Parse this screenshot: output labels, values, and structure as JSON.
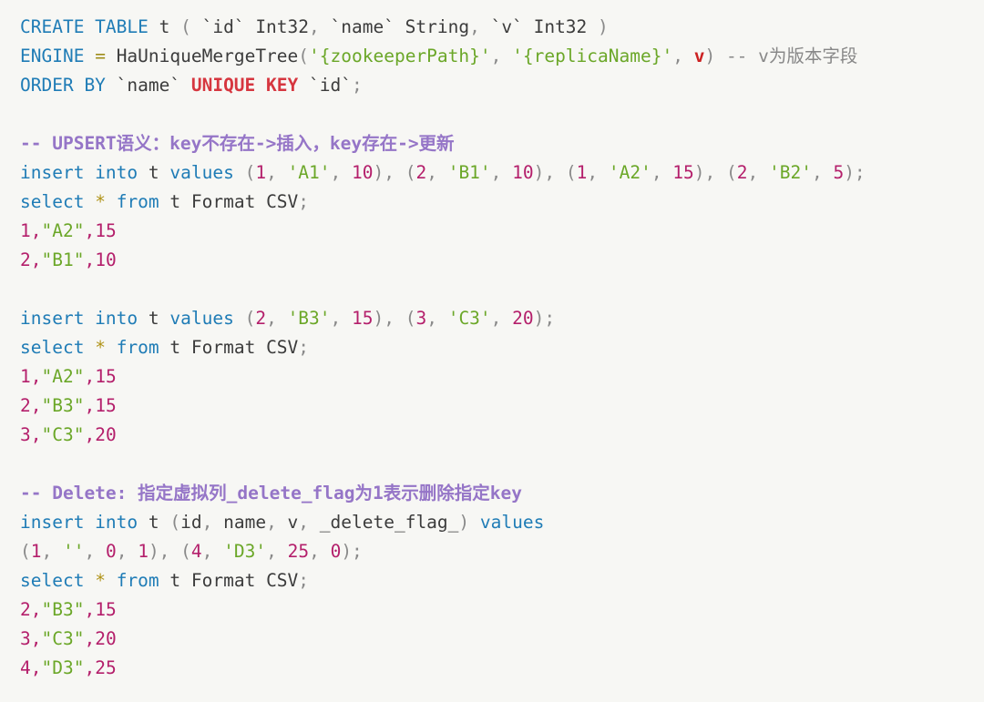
{
  "editor": {
    "language": "sql",
    "background_color": "#f7f7f4",
    "default_text_color": "#3c3c3c",
    "colors": {
      "keyword": "#1f7cb6",
      "keyword_emphasis": "#d6363f",
      "string": "#6ba728",
      "number": "#b41f6b",
      "punctuation": "#8a8a8a",
      "comment": "#888888",
      "comment_cjk": "#9575c7",
      "operator": "#9e8c18"
    }
  },
  "lines": [
    {
      "id": "line-1",
      "text": "CREATE TABLE t ( `id` Int32, `name` String, `v` Int32 )",
      "tokens": [
        {
          "t": "CREATE TABLE",
          "c": "kw"
        },
        {
          "t": " t ",
          "c": "ident"
        },
        {
          "t": "(",
          "c": "punc"
        },
        {
          "t": " `id` Int32",
          "c": "ident"
        },
        {
          "t": ",",
          "c": "punc"
        },
        {
          "t": " `name` String",
          "c": "ident"
        },
        {
          "t": ",",
          "c": "punc"
        },
        {
          "t": " `v` Int32 ",
          "c": "ident"
        },
        {
          "t": ")",
          "c": "punc"
        }
      ]
    },
    {
      "id": "line-2",
      "text": "ENGINE = HaUniqueMergeTree('{zookeeperPath}', '{replicaName}', v) -- v为版本字段",
      "tokens": [
        {
          "t": "ENGINE",
          "c": "kw"
        },
        {
          "t": " ",
          "c": "ident"
        },
        {
          "t": "=",
          "c": "op"
        },
        {
          "t": " HaUniqueMergeTree",
          "c": "ident"
        },
        {
          "t": "(",
          "c": "punc"
        },
        {
          "t": "'{zookeeperPath}'",
          "c": "str"
        },
        {
          "t": ", ",
          "c": "punc"
        },
        {
          "t": "'{replicaName}'",
          "c": "str"
        },
        {
          "t": ", ",
          "c": "punc"
        },
        {
          "t": "v",
          "c": "vcol"
        },
        {
          "t": ")",
          "c": "punc"
        },
        {
          "t": " -- v为版本字段",
          "c": "cmt"
        }
      ]
    },
    {
      "id": "line-3",
      "text": "ORDER BY `name` UNIQUE KEY `id`;",
      "tokens": [
        {
          "t": "ORDER BY",
          "c": "kw"
        },
        {
          "t": " `name` ",
          "c": "ident"
        },
        {
          "t": "UNIQUE KEY",
          "c": "kw2"
        },
        {
          "t": " `id`",
          "c": "ident"
        },
        {
          "t": ";",
          "c": "punc"
        }
      ]
    },
    {
      "id": "line-4",
      "text": "",
      "tokens": []
    },
    {
      "id": "line-5",
      "text": "-- UPSERT语义：key不存在->插入，key存在->更新",
      "tokens": [
        {
          "t": "-- UPSERT语义：key不存在->插入，key存在->更新",
          "c": "cmt-cn"
        }
      ]
    },
    {
      "id": "line-6",
      "text": "insert into t values (1, 'A1', 10), (2, 'B1', 10), (1, 'A2', 15), (2, 'B2', 5);",
      "tokens": [
        {
          "t": "insert into",
          "c": "kw"
        },
        {
          "t": " t ",
          "c": "ident"
        },
        {
          "t": "values",
          "c": "kw"
        },
        {
          "t": " ",
          "c": "ident"
        },
        {
          "t": "(",
          "c": "punc"
        },
        {
          "t": "1",
          "c": "num"
        },
        {
          "t": ", ",
          "c": "punc"
        },
        {
          "t": "'A1'",
          "c": "str"
        },
        {
          "t": ", ",
          "c": "punc"
        },
        {
          "t": "10",
          "c": "num"
        },
        {
          "t": "), (",
          "c": "punc"
        },
        {
          "t": "2",
          "c": "num"
        },
        {
          "t": ", ",
          "c": "punc"
        },
        {
          "t": "'B1'",
          "c": "str"
        },
        {
          "t": ", ",
          "c": "punc"
        },
        {
          "t": "10",
          "c": "num"
        },
        {
          "t": "), (",
          "c": "punc"
        },
        {
          "t": "1",
          "c": "num"
        },
        {
          "t": ", ",
          "c": "punc"
        },
        {
          "t": "'A2'",
          "c": "str"
        },
        {
          "t": ", ",
          "c": "punc"
        },
        {
          "t": "15",
          "c": "num"
        },
        {
          "t": "), (",
          "c": "punc"
        },
        {
          "t": "2",
          "c": "num"
        },
        {
          "t": ", ",
          "c": "punc"
        },
        {
          "t": "'B2'",
          "c": "str"
        },
        {
          "t": ", ",
          "c": "punc"
        },
        {
          "t": "5",
          "c": "num"
        },
        {
          "t": ");",
          "c": "punc"
        }
      ]
    },
    {
      "id": "line-7",
      "text": "select * from t Format CSV;",
      "tokens": [
        {
          "t": "select",
          "c": "kw"
        },
        {
          "t": " ",
          "c": "ident"
        },
        {
          "t": "*",
          "c": "star"
        },
        {
          "t": " ",
          "c": "ident"
        },
        {
          "t": "from",
          "c": "kw"
        },
        {
          "t": " t Format CSV",
          "c": "ident"
        },
        {
          "t": ";",
          "c": "punc"
        }
      ]
    },
    {
      "id": "line-8",
      "text": "1,\"A2\",15",
      "tokens": [
        {
          "t": "1",
          "c": "res-num"
        },
        {
          "t": ",",
          "c": "res-sep"
        },
        {
          "t": "\"A2\"",
          "c": "res-str"
        },
        {
          "t": ",",
          "c": "res-sep"
        },
        {
          "t": "15",
          "c": "res-num"
        }
      ]
    },
    {
      "id": "line-9",
      "text": "2,\"B1\",10",
      "tokens": [
        {
          "t": "2",
          "c": "res-num"
        },
        {
          "t": ",",
          "c": "res-sep"
        },
        {
          "t": "\"B1\"",
          "c": "res-str"
        },
        {
          "t": ",",
          "c": "res-sep"
        },
        {
          "t": "10",
          "c": "res-num"
        }
      ]
    },
    {
      "id": "line-10",
      "text": "",
      "tokens": []
    },
    {
      "id": "line-11",
      "text": "insert into t values (2, 'B3', 15), (3, 'C3', 20);",
      "tokens": [
        {
          "t": "insert into",
          "c": "kw"
        },
        {
          "t": " t ",
          "c": "ident"
        },
        {
          "t": "values",
          "c": "kw"
        },
        {
          "t": " ",
          "c": "ident"
        },
        {
          "t": "(",
          "c": "punc"
        },
        {
          "t": "2",
          "c": "num"
        },
        {
          "t": ", ",
          "c": "punc"
        },
        {
          "t": "'B3'",
          "c": "str"
        },
        {
          "t": ", ",
          "c": "punc"
        },
        {
          "t": "15",
          "c": "num"
        },
        {
          "t": "), (",
          "c": "punc"
        },
        {
          "t": "3",
          "c": "num"
        },
        {
          "t": ", ",
          "c": "punc"
        },
        {
          "t": "'C3'",
          "c": "str"
        },
        {
          "t": ", ",
          "c": "punc"
        },
        {
          "t": "20",
          "c": "num"
        },
        {
          "t": ");",
          "c": "punc"
        }
      ]
    },
    {
      "id": "line-12",
      "text": "select * from t Format CSV;",
      "tokens": [
        {
          "t": "select",
          "c": "kw"
        },
        {
          "t": " ",
          "c": "ident"
        },
        {
          "t": "*",
          "c": "star"
        },
        {
          "t": " ",
          "c": "ident"
        },
        {
          "t": "from",
          "c": "kw"
        },
        {
          "t": " t Format CSV",
          "c": "ident"
        },
        {
          "t": ";",
          "c": "punc"
        }
      ]
    },
    {
      "id": "line-13",
      "text": "1,\"A2\",15",
      "tokens": [
        {
          "t": "1",
          "c": "res-num"
        },
        {
          "t": ",",
          "c": "res-sep"
        },
        {
          "t": "\"A2\"",
          "c": "res-str"
        },
        {
          "t": ",",
          "c": "res-sep"
        },
        {
          "t": "15",
          "c": "res-num"
        }
      ]
    },
    {
      "id": "line-14",
      "text": "2,\"B3\",15",
      "tokens": [
        {
          "t": "2",
          "c": "res-num"
        },
        {
          "t": ",",
          "c": "res-sep"
        },
        {
          "t": "\"B3\"",
          "c": "res-str"
        },
        {
          "t": ",",
          "c": "res-sep"
        },
        {
          "t": "15",
          "c": "res-num"
        }
      ]
    },
    {
      "id": "line-15",
      "text": "3,\"C3\",20",
      "tokens": [
        {
          "t": "3",
          "c": "res-num"
        },
        {
          "t": ",",
          "c": "res-sep"
        },
        {
          "t": "\"C3\"",
          "c": "res-str"
        },
        {
          "t": ",",
          "c": "res-sep"
        },
        {
          "t": "20",
          "c": "res-num"
        }
      ]
    },
    {
      "id": "line-16",
      "text": "",
      "tokens": []
    },
    {
      "id": "line-17",
      "text": "-- Delete: 指定虚拟列_delete_flag为1表示删除指定key",
      "tokens": [
        {
          "t": "-- Delete: 指定虚拟列_delete_flag为1表示删除指定key",
          "c": "cmt-cn"
        }
      ]
    },
    {
      "id": "line-18",
      "text": "insert into t (id, name, v, _delete_flag_) values",
      "tokens": [
        {
          "t": "insert into",
          "c": "kw"
        },
        {
          "t": " t ",
          "c": "ident"
        },
        {
          "t": "(",
          "c": "punc"
        },
        {
          "t": "id",
          "c": "ident"
        },
        {
          "t": ", ",
          "c": "punc"
        },
        {
          "t": "name",
          "c": "ident"
        },
        {
          "t": ", ",
          "c": "punc"
        },
        {
          "t": "v",
          "c": "ident"
        },
        {
          "t": ", ",
          "c": "punc"
        },
        {
          "t": "_delete_flag_",
          "c": "ident"
        },
        {
          "t": ")",
          "c": "punc"
        },
        {
          "t": " ",
          "c": "ident"
        },
        {
          "t": "values",
          "c": "kw"
        }
      ]
    },
    {
      "id": "line-19",
      "text": "(1, '', 0, 1), (4, 'D3', 25, 0);",
      "tokens": [
        {
          "t": "(",
          "c": "punc"
        },
        {
          "t": "1",
          "c": "num"
        },
        {
          "t": ", ",
          "c": "punc"
        },
        {
          "t": "''",
          "c": "str"
        },
        {
          "t": ", ",
          "c": "punc"
        },
        {
          "t": "0",
          "c": "num"
        },
        {
          "t": ", ",
          "c": "punc"
        },
        {
          "t": "1",
          "c": "num"
        },
        {
          "t": "), (",
          "c": "punc"
        },
        {
          "t": "4",
          "c": "num"
        },
        {
          "t": ", ",
          "c": "punc"
        },
        {
          "t": "'D3'",
          "c": "str"
        },
        {
          "t": ", ",
          "c": "punc"
        },
        {
          "t": "25",
          "c": "num"
        },
        {
          "t": ", ",
          "c": "punc"
        },
        {
          "t": "0",
          "c": "num"
        },
        {
          "t": ");",
          "c": "punc"
        }
      ]
    },
    {
      "id": "line-20",
      "text": "select * from t Format CSV;",
      "tokens": [
        {
          "t": "select",
          "c": "kw"
        },
        {
          "t": " ",
          "c": "ident"
        },
        {
          "t": "*",
          "c": "star"
        },
        {
          "t": " ",
          "c": "ident"
        },
        {
          "t": "from",
          "c": "kw"
        },
        {
          "t": " t Format CSV",
          "c": "ident"
        },
        {
          "t": ";",
          "c": "punc"
        }
      ]
    },
    {
      "id": "line-21",
      "text": "2,\"B3\",15",
      "tokens": [
        {
          "t": "2",
          "c": "res-num"
        },
        {
          "t": ",",
          "c": "res-sep"
        },
        {
          "t": "\"B3\"",
          "c": "res-str"
        },
        {
          "t": ",",
          "c": "res-sep"
        },
        {
          "t": "15",
          "c": "res-num"
        }
      ]
    },
    {
      "id": "line-22",
      "text": "3,\"C3\",20",
      "tokens": [
        {
          "t": "3",
          "c": "res-num"
        },
        {
          "t": ",",
          "c": "res-sep"
        },
        {
          "t": "\"C3\"",
          "c": "res-str"
        },
        {
          "t": ",",
          "c": "res-sep"
        },
        {
          "t": "20",
          "c": "res-num"
        }
      ]
    },
    {
      "id": "line-23",
      "text": "4,\"D3\",25",
      "tokens": [
        {
          "t": "4",
          "c": "res-num"
        },
        {
          "t": ",",
          "c": "res-sep"
        },
        {
          "t": "\"D3\"",
          "c": "res-str"
        },
        {
          "t": ",",
          "c": "res-sep"
        },
        {
          "t": "25",
          "c": "res-num"
        }
      ]
    }
  ]
}
